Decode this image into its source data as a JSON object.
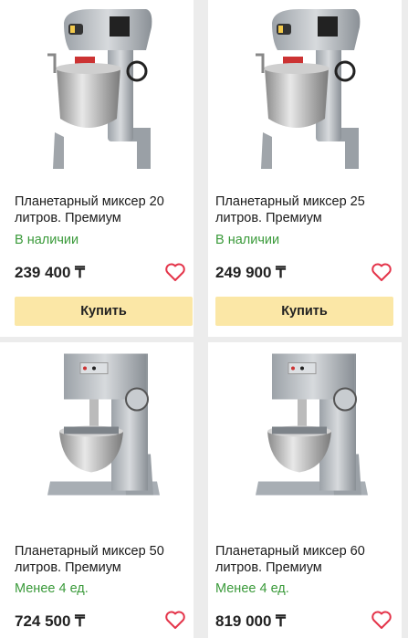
{
  "products": [
    {
      "title": "Планетарный миксер 20 литров. Премиум",
      "stock": "В наличии",
      "price": "239 400 ₸",
      "buy": "Купить"
    },
    {
      "title": "Планетарный миксер 25 литров. Премиум",
      "stock": "В наличии",
      "price": "249 900 ₸",
      "buy": "Купить"
    },
    {
      "title": "Планетарный миксер 50 литров. Премиум",
      "stock": "Менее 4 ед.",
      "price": "724 500 ₸"
    },
    {
      "title": "Планетарный миксер 60 литров. Премиум",
      "stock": "Менее 4 ед.",
      "price": "819 000 ₸"
    }
  ],
  "colors": {
    "accent_button": "#fbe7a6",
    "stock_green": "#3a9a3a",
    "heart_red": "#e4344a"
  },
  "icons": {
    "favorite": "heart-outline-icon"
  }
}
